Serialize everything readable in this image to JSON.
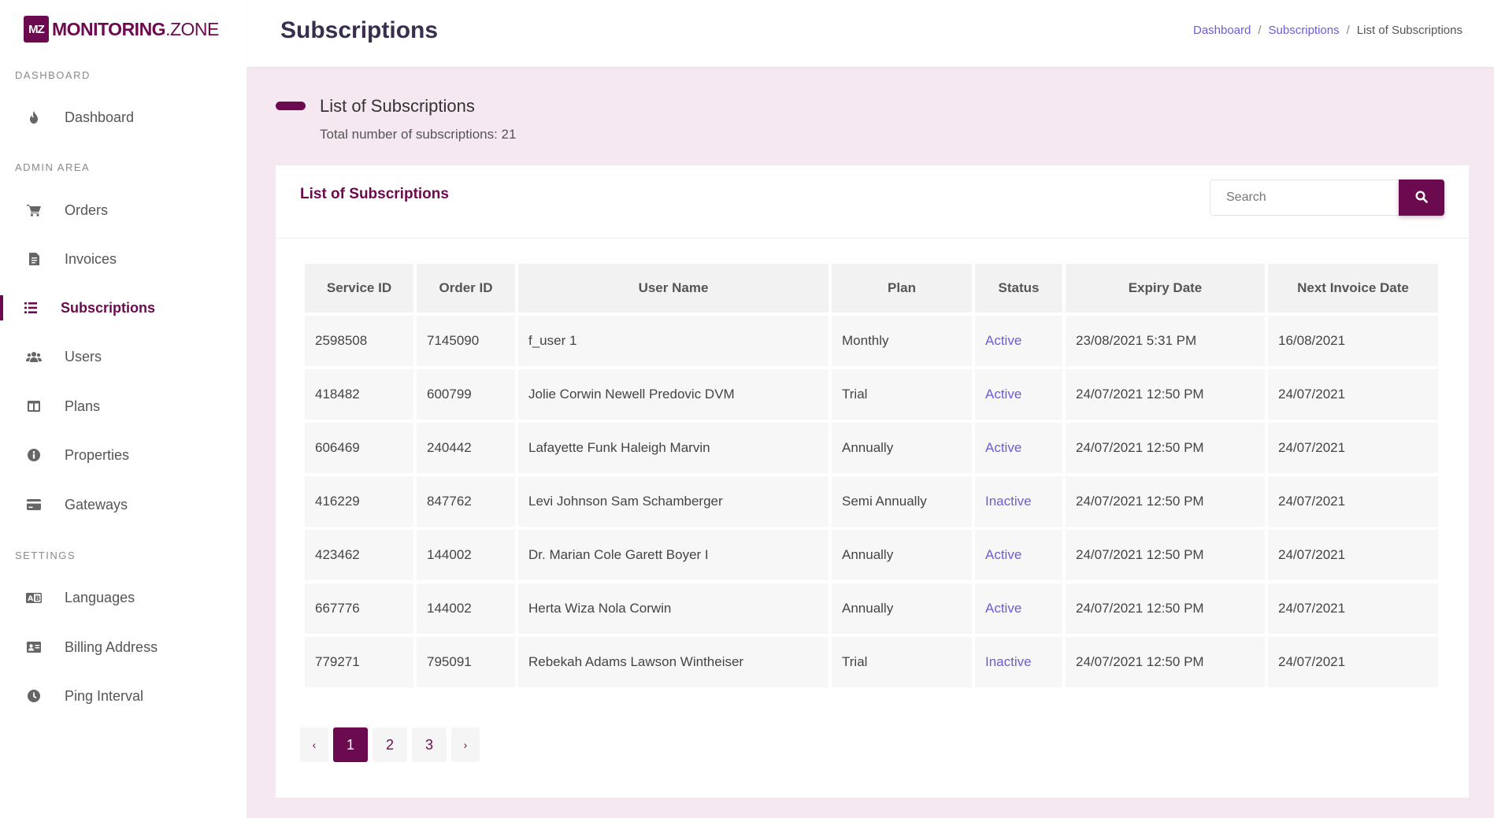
{
  "app": {
    "logo_mark": "MZ",
    "logo_bold": "MONITORING",
    "logo_rest": ".ZONE"
  },
  "sidebar": {
    "sections": [
      {
        "title": "DASHBOARD"
      },
      {
        "title": "ADMIN AREA"
      },
      {
        "title": "SETTINGS"
      }
    ],
    "items": [
      {
        "label": "Dashboard",
        "icon": "fire-icon"
      },
      {
        "label": "Orders",
        "icon": "cart-icon"
      },
      {
        "label": "Invoices",
        "icon": "invoice-icon"
      },
      {
        "label": "Subscriptions",
        "icon": "list-icon",
        "active": true
      },
      {
        "label": "Users",
        "icon": "users-icon"
      },
      {
        "label": "Plans",
        "icon": "columns-icon"
      },
      {
        "label": "Properties",
        "icon": "info-icon"
      },
      {
        "label": "Gateways",
        "icon": "credit-card-icon"
      },
      {
        "label": "Languages",
        "icon": "language-icon"
      },
      {
        "label": "Billing Address",
        "icon": "address-card-icon"
      },
      {
        "label": "Ping Interval",
        "icon": "clock-icon"
      }
    ]
  },
  "header": {
    "title": "Subscriptions",
    "breadcrumb": [
      "Dashboard",
      "Subscriptions",
      "List of Subscriptions"
    ]
  },
  "section": {
    "title": "List of Subscriptions",
    "subtitle": "Total number of subscriptions: 21"
  },
  "card": {
    "title": "List of Subscriptions",
    "search_placeholder": "Search"
  },
  "table": {
    "columns": [
      "Service ID",
      "Order ID",
      "User Name",
      "Plan",
      "Status",
      "Expiry Date",
      "Next Invoice Date"
    ],
    "rows": [
      [
        "2598508",
        "7145090",
        "f_user 1",
        "Monthly",
        "Active",
        "23/08/2021 5:31 PM",
        "16/08/2021"
      ],
      [
        "418482",
        "600799",
        "Jolie Corwin Newell Predovic DVM",
        "Trial",
        "Active",
        "24/07/2021 12:50 PM",
        "24/07/2021"
      ],
      [
        "606469",
        "240442",
        "Lafayette Funk Haleigh Marvin",
        "Annually",
        "Active",
        "24/07/2021 12:50 PM",
        "24/07/2021"
      ],
      [
        "416229",
        "847762",
        "Levi Johnson Sam Schamberger",
        "Semi Annually",
        "Inactive",
        "24/07/2021 12:50 PM",
        "24/07/2021"
      ],
      [
        "423462",
        "144002",
        "Dr. Marian Cole Garett Boyer I",
        "Annually",
        "Active",
        "24/07/2021 12:50 PM",
        "24/07/2021"
      ],
      [
        "667776",
        "144002",
        "Herta Wiza Nola Corwin",
        "Annually",
        "Active",
        "24/07/2021 12:50 PM",
        "24/07/2021"
      ],
      [
        "779271",
        "795091",
        "Rebekah Adams Lawson Wintheiser",
        "Trial",
        "Inactive",
        "24/07/2021 12:50 PM",
        "24/07/2021"
      ]
    ]
  },
  "pagination": {
    "prev": "‹",
    "pages": [
      "1",
      "2",
      "3"
    ],
    "current": "1",
    "next": "›"
  },
  "colors": {
    "brand": "#6b0a4f",
    "link": "#6f5bd6",
    "page_bg": "#f6e8f1"
  }
}
